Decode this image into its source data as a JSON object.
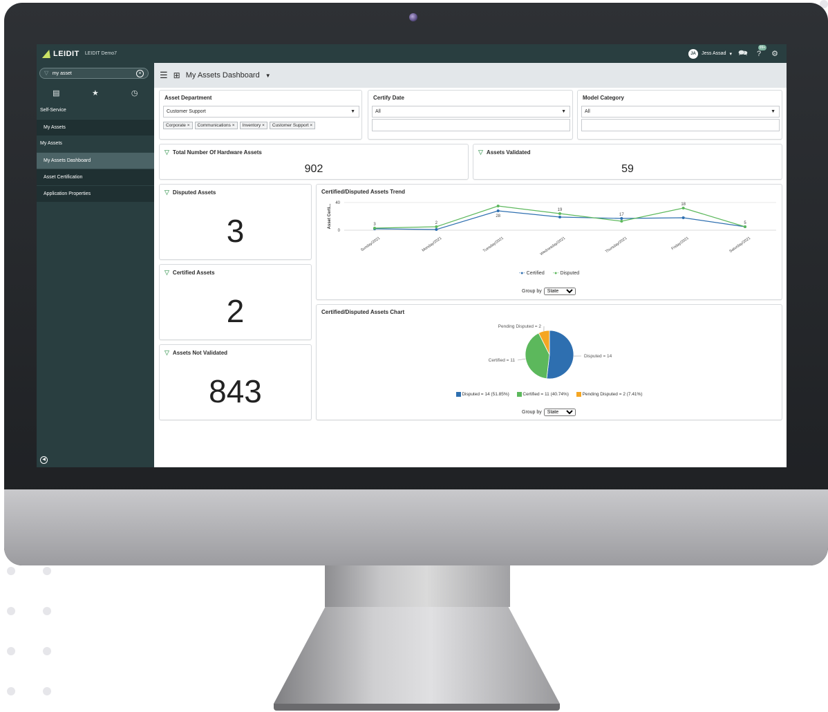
{
  "app": {
    "brand": "LEIDIT",
    "instance": "LEIDIT Demo7",
    "user_initials": "JA",
    "user_name": "Jess Assad",
    "notification_count": "99+"
  },
  "sidebar": {
    "search_value": "my asset",
    "sections": [
      {
        "label": "Self-Service",
        "items": [
          {
            "label": "My Assets",
            "active": false
          }
        ]
      },
      {
        "label": "My Assets",
        "items": [
          {
            "label": "My Assets Dashboard",
            "active": true
          },
          {
            "label": "Asset Certification",
            "active": false
          },
          {
            "label": "Application Properties",
            "active": false
          }
        ]
      }
    ]
  },
  "header": {
    "title": "My Assets Dashboard"
  },
  "filters": [
    {
      "title": "Asset Department",
      "selected": "Customer Support",
      "chips": [
        "Corporate ×",
        "Communications ×",
        "Inventory ×",
        "Customer Support ×"
      ]
    },
    {
      "title": "Certify Date",
      "selected": "All"
    },
    {
      "title": "Model Category",
      "selected": "All"
    }
  ],
  "kpis": {
    "total_hardware": {
      "title": "Total Number Of Hardware Assets",
      "value": "902"
    },
    "validated": {
      "title": "Assets Validated",
      "value": "59"
    },
    "disputed": {
      "title": "Disputed Assets",
      "value": "3"
    },
    "certified": {
      "title": "Certified Assets",
      "value": "2"
    },
    "not_validated": {
      "title": "Assets Not Validated",
      "value": "843"
    }
  },
  "trend": {
    "title": "Certified/Disputed Assets Trend",
    "group_by_label": "Group by",
    "group_by_value": "State"
  },
  "pie": {
    "title": "Certified/Disputed Assets Chart",
    "group_by_label": "Group by",
    "group_by_value": "State"
  },
  "chart_data": [
    {
      "type": "line",
      "title": "Certified/Disputed Assets Trend",
      "ylabel": "Asset Certi...",
      "ylim": [
        0,
        40
      ],
      "y_ticks": [
        "40",
        "0"
      ],
      "categories": [
        "Sunday/2021",
        "Monday/2021",
        "Tuesday/2021",
        "Wednesday/2021",
        "Thursday/2021",
        "Friday/2021",
        "Saturday/2021"
      ],
      "series": [
        {
          "name": "Certified",
          "color": "#2e6fb0",
          "values": [
            2,
            1,
            28,
            19,
            17,
            18,
            5
          ]
        },
        {
          "name": "Disputed",
          "color": "#5cb85c",
          "values": [
            3,
            5,
            35,
            24,
            13,
            32,
            5
          ]
        }
      ],
      "data_labels": [
        {
          "category": "Sunday/2021",
          "value": 3
        },
        {
          "category": "Monday/2021",
          "value": 2
        },
        {
          "category": "Tuesday/2021",
          "value": 28
        },
        {
          "category": "Wednesday/2021",
          "value": 19
        },
        {
          "category": "Thursday/2021",
          "value": 17
        },
        {
          "category": "Friday/2021",
          "value": 18
        },
        {
          "category": "Saturday/2021",
          "value": 5
        }
      ],
      "legend": "bottom-center"
    },
    {
      "type": "pie",
      "title": "Certified/Disputed Assets Chart",
      "slices": [
        {
          "label": "Disputed = 14",
          "value": 14,
          "percent": 51.85,
          "color": "#2e6fb0",
          "legend": "Disputed = 14 (51.85%)"
        },
        {
          "label": "Certified = 11",
          "value": 11,
          "percent": 40.74,
          "color": "#5cb85c",
          "legend": "Certified = 11 (40.74%)"
        },
        {
          "label": "Pending Disputed = 2",
          "value": 2,
          "percent": 7.41,
          "color": "#f5a623",
          "legend": "Pending Disputed = 2 (7.41%)"
        }
      ],
      "legend": "bottom-center"
    }
  ]
}
